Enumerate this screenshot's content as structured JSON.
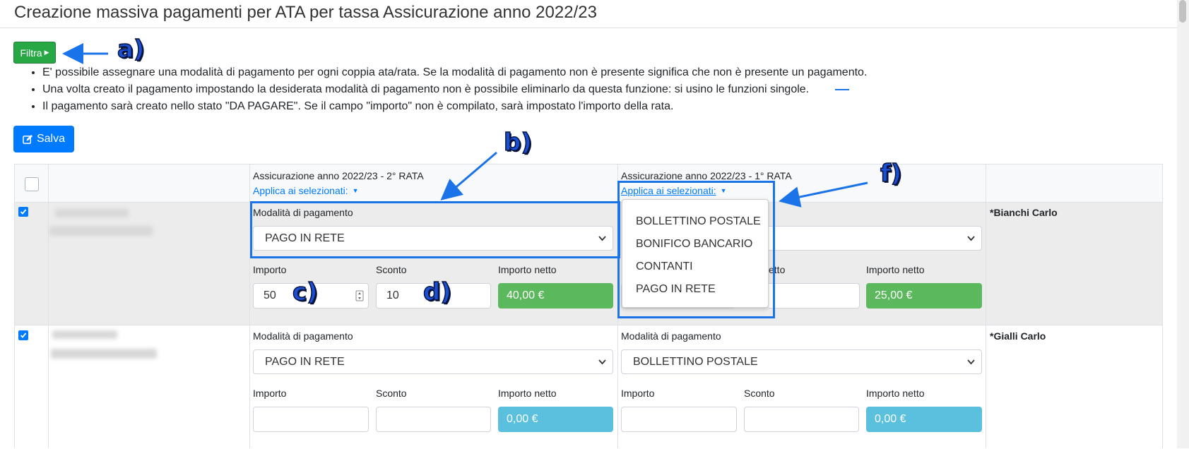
{
  "page": {
    "title": "Creazione massiva pagamenti per ATA per tassa Assicurazione anno 2022/23"
  },
  "toolbar": {
    "filter_label": "Filtra",
    "save_label": "Salva"
  },
  "notes": [
    "E' possibile assegnare una modalità di pagamento per ogni coppia ata/rata. Se la modalità di pagamento non è presente significa che non è presente un pagamento.",
    "Una volta creato il pagamento impostando la desiderata modalità di pagamento non è possibile eliminarlo da questa funzione: si usino le funzioni singole.",
    "Il pagamento sarà creato nello stato \"DA PAGARE\". Se il campo \"importo\" non è compilato, sarà impostato l'importo della rata."
  ],
  "columns": [
    {
      "title": "Assicurazione anno 2022/23 - 2° RATA",
      "apply_label": "Applica ai selezionati:"
    },
    {
      "title": "Assicurazione anno 2022/23 - 1° RATA",
      "apply_label": "Applica ai selezionati:"
    }
  ],
  "labels": {
    "mode": "Modalità di pagamento",
    "amount": "Importo",
    "discount": "Sconto",
    "net": "Importo netto",
    "net_partial": "etto",
    "net_partial2": "tto"
  },
  "rows": [
    {
      "checked": true,
      "name": "*Bianchi Carlo",
      "rata2": {
        "mode": "PAGO IN RETE",
        "amount": "50",
        "discount": "10",
        "net": "40,00 €"
      },
      "rata1": {
        "net": "25,00 €"
      }
    },
    {
      "checked": true,
      "name": "*Gialli Carlo",
      "rata2": {
        "mode": "PAGO IN RETE",
        "amount": "",
        "discount": "",
        "net": "0,00 €"
      },
      "rata1": {
        "mode": "BOLLETTINO POSTALE",
        "amount": "",
        "discount": "",
        "net": "0,00 €"
      }
    }
  ],
  "dropdown": {
    "options": [
      "BOLLETTINO POSTALE",
      "BONIFICO BANCARIO",
      "CONTANTI",
      "PAGO IN RETE"
    ]
  },
  "annotations": {
    "a": "a)",
    "b": "b)",
    "c": "c)",
    "d": "d)",
    "f": "f)"
  },
  "colors": {
    "primary": "#007bff",
    "success": "#28a745",
    "net_filled": "#5cb85c",
    "net_empty": "#5bc0de",
    "annotation": "#1a73e8"
  }
}
